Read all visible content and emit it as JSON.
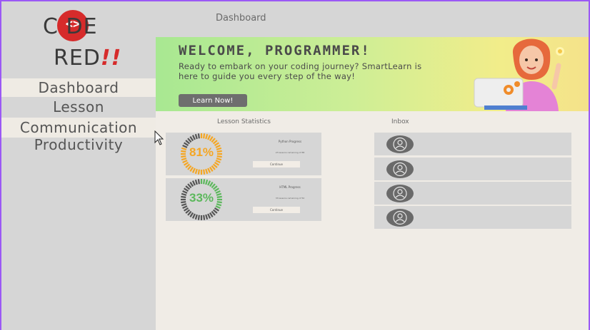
{
  "app": {
    "logo_line1": "C    DE",
    "logo_code_glyph": "<>",
    "logo_line2": "RED",
    "logo_bang": "!!"
  },
  "header": {
    "title": "Dashboard"
  },
  "sidebar": {
    "items": [
      {
        "label": "Dashboard"
      },
      {
        "label": "Lesson"
      },
      {
        "label": "Communication"
      },
      {
        "label": "Productivity"
      }
    ]
  },
  "banner": {
    "heading": "WELCOME, PROGRAMMER!",
    "text": "Ready to embark on your coding journey? SmartLearn is here to guide you every step of the way!",
    "button_label": "Learn Now!"
  },
  "lesson_statistics": {
    "label": "Lesson Statistics",
    "cards": [
      {
        "percent_label": "81%",
        "progress": 0.81,
        "title": "Python Progress",
        "subtitle": "23 lessons remaining of 88",
        "button": "Continue",
        "color": "#f5a623"
      },
      {
        "percent_label": "33%",
        "progress": 0.33,
        "title": "HTML Progress",
        "subtitle": "33 lessons remaining of 50",
        "button": "Continue",
        "color": "#5cb85c"
      }
    ]
  },
  "inbox": {
    "label": "Inbox",
    "rows": 4
  },
  "colors": {
    "sidebar": "#d6d6d6",
    "content_bg": "#f0ece6",
    "frame_border": "#9b59f5",
    "accent_red": "#d62b2b"
  }
}
